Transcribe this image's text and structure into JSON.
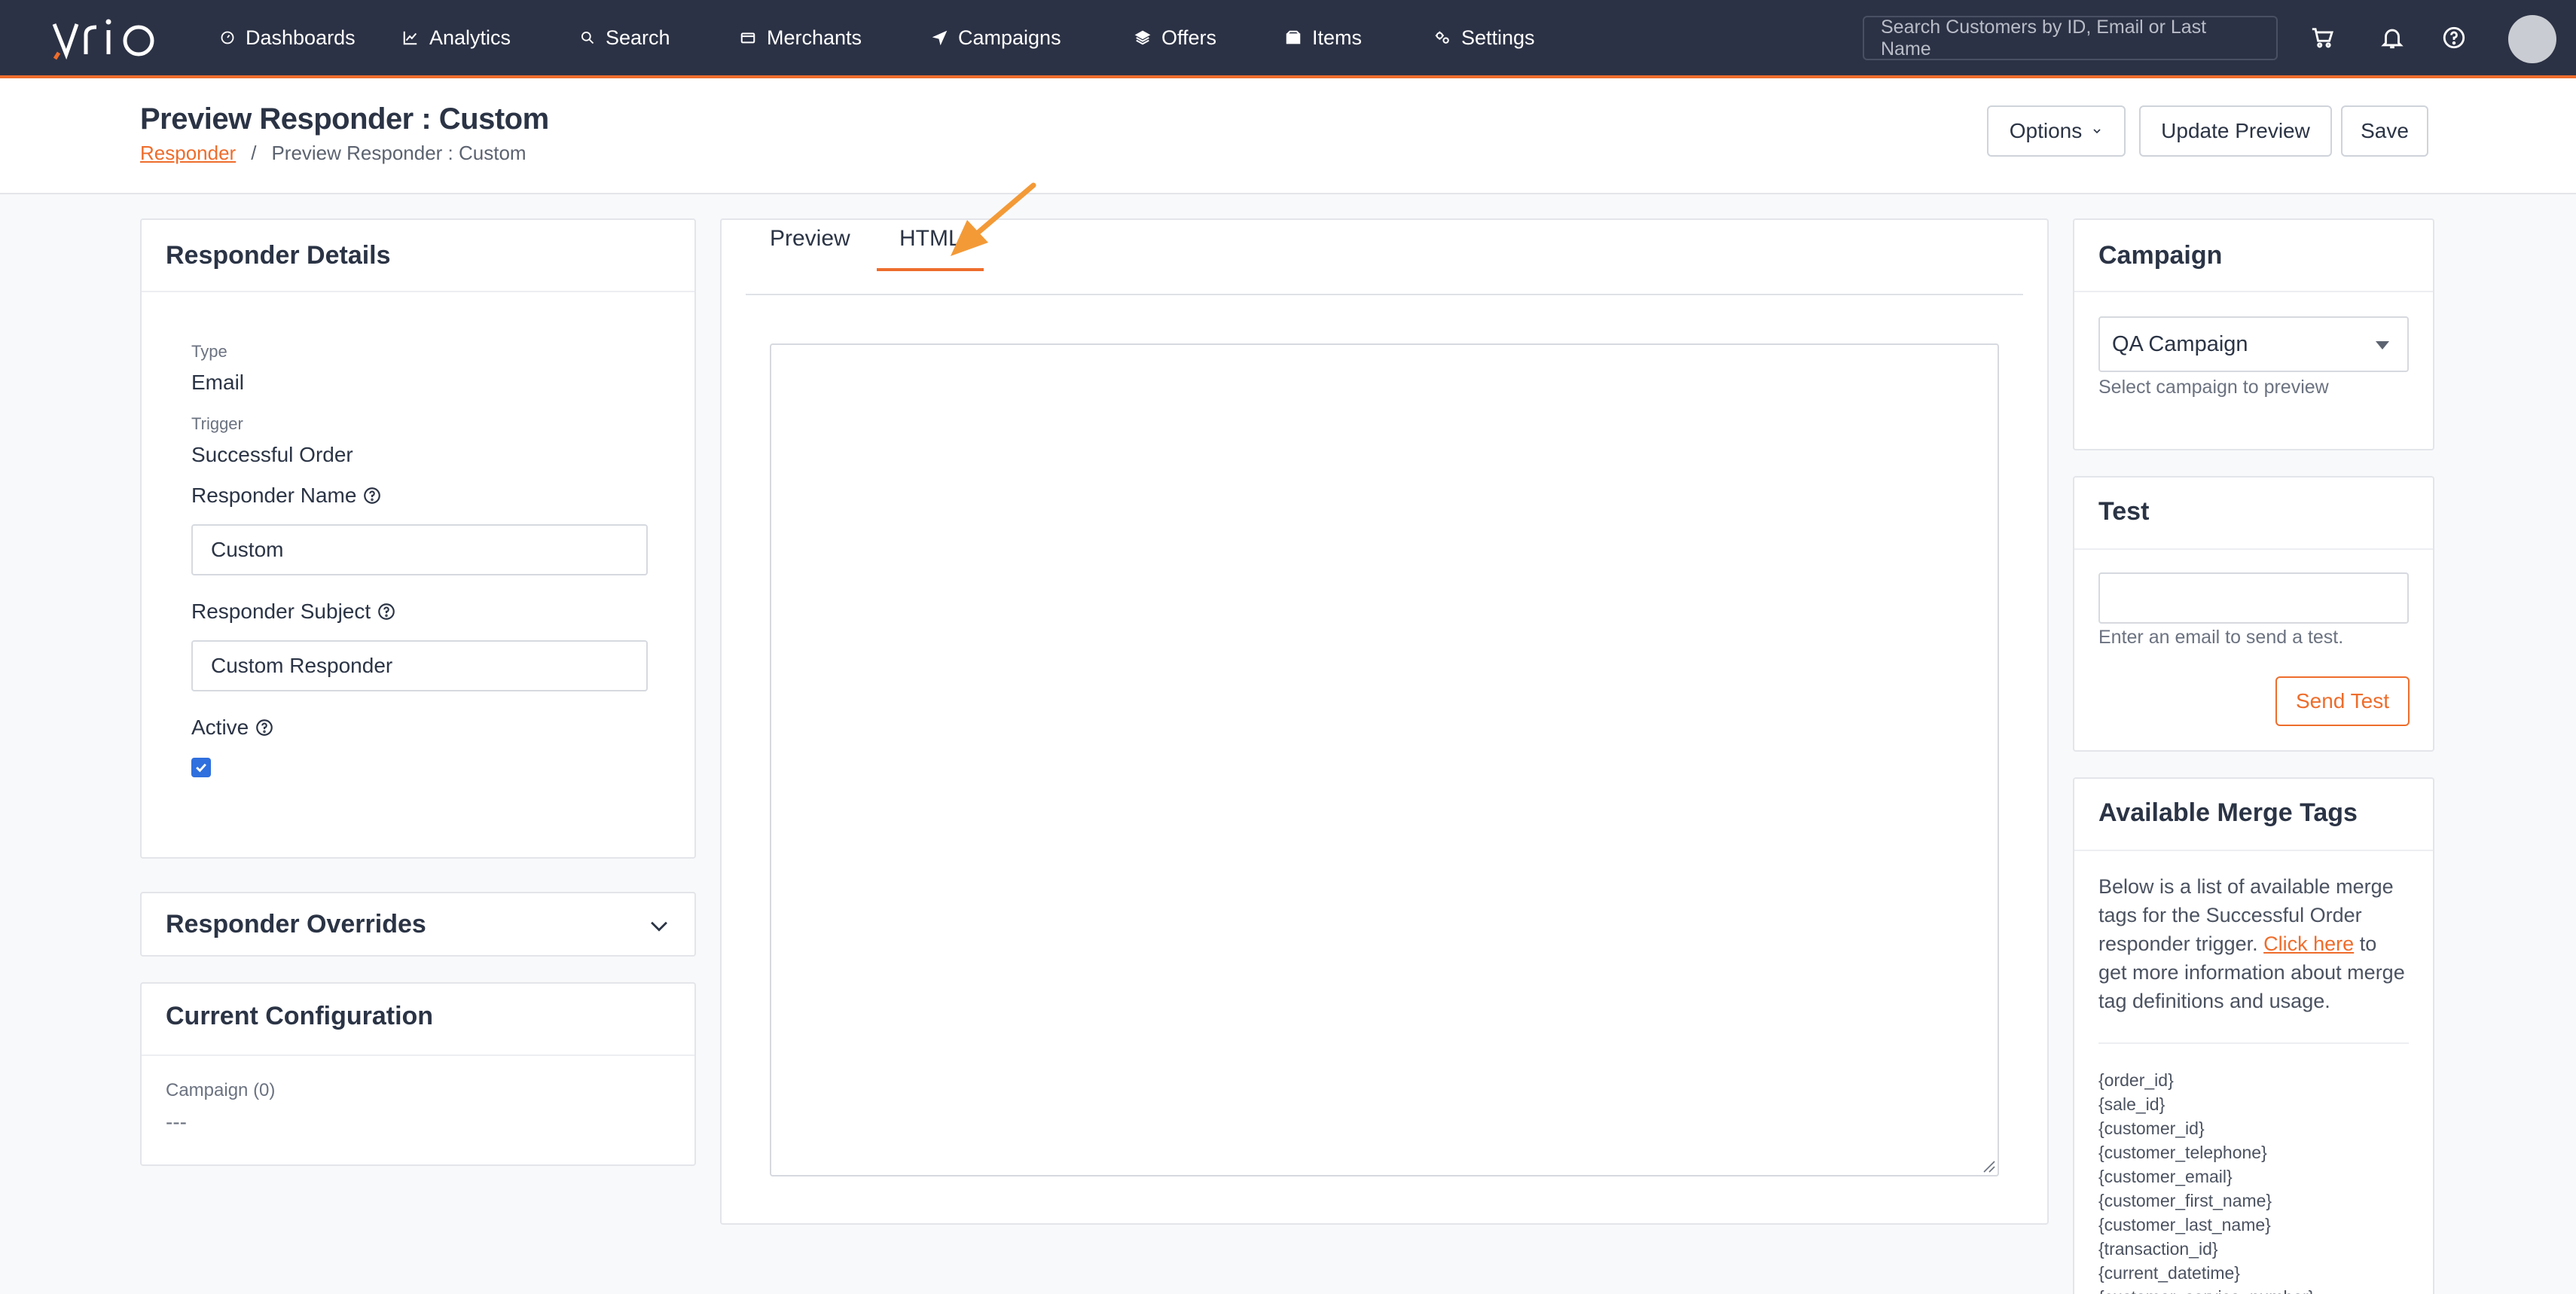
{
  "app": {
    "logo_text": "vrio"
  },
  "nav": {
    "items": [
      {
        "label": "Dashboards",
        "icon": "dashboard-icon"
      },
      {
        "label": "Analytics",
        "icon": "chart-icon"
      },
      {
        "label": "Search",
        "icon": "search-icon"
      },
      {
        "label": "Merchants",
        "icon": "card-icon"
      },
      {
        "label": "Campaigns",
        "icon": "send-icon"
      },
      {
        "label": "Offers",
        "icon": "layers-icon"
      },
      {
        "label": "Items",
        "icon": "box-icon"
      },
      {
        "label": "Settings",
        "icon": "gears-icon"
      }
    ],
    "active": "Settings",
    "search_placeholder": "Search Customers by ID, Email or Last Name"
  },
  "header": {
    "title": "Preview Responder : Custom",
    "breadcrumb": {
      "link": "Responder",
      "separator": "/",
      "current": "Preview Responder : Custom"
    },
    "options_label": "Options",
    "update_label": "Update Preview",
    "save_label": "Save"
  },
  "details": {
    "title": "Responder Details",
    "type_label": "Type",
    "type_value": "Email",
    "trigger_label": "Trigger",
    "trigger_value": "Successful Order",
    "name_label": "Responder Name",
    "name_value": "Custom",
    "subject_label": "Responder Subject",
    "subject_value": "Custom Responder",
    "active_label": "Active",
    "active_checked": true
  },
  "overrides": {
    "title": "Responder Overrides"
  },
  "config": {
    "title": "Current Configuration",
    "campaign_label": "Campaign (0)",
    "campaign_value": "---"
  },
  "editor": {
    "tabs": [
      "Preview",
      "HTML"
    ],
    "active_tab": "HTML",
    "content": ""
  },
  "campaign": {
    "title": "Campaign",
    "selected": "QA Campaign",
    "helper": "Select campaign to preview"
  },
  "test": {
    "title": "Test",
    "email_value": "",
    "helper": "Enter an email to send a test.",
    "button_label": "Send Test"
  },
  "merge": {
    "title": "Available Merge Tags",
    "desc_before": "Below is a list of available merge tags for the Successful Order responder trigger.",
    "link_text": "Click here",
    "desc_after": "to get more information about merge tag definitions and usage.",
    "tags": [
      "{order_id}",
      "{sale_id}",
      "{customer_id}",
      "{customer_telephone}",
      "{customer_email}",
      "{customer_first_name}",
      "{customer_last_name}",
      "{transaction_id}",
      "{current_datetime}",
      "{customer_service_number}"
    ]
  },
  "colors": {
    "navbar": "#2c3245",
    "accent": "#ee6d2c",
    "annotation_arrow": "#f39a37",
    "checkbox": "#2f6fde"
  }
}
